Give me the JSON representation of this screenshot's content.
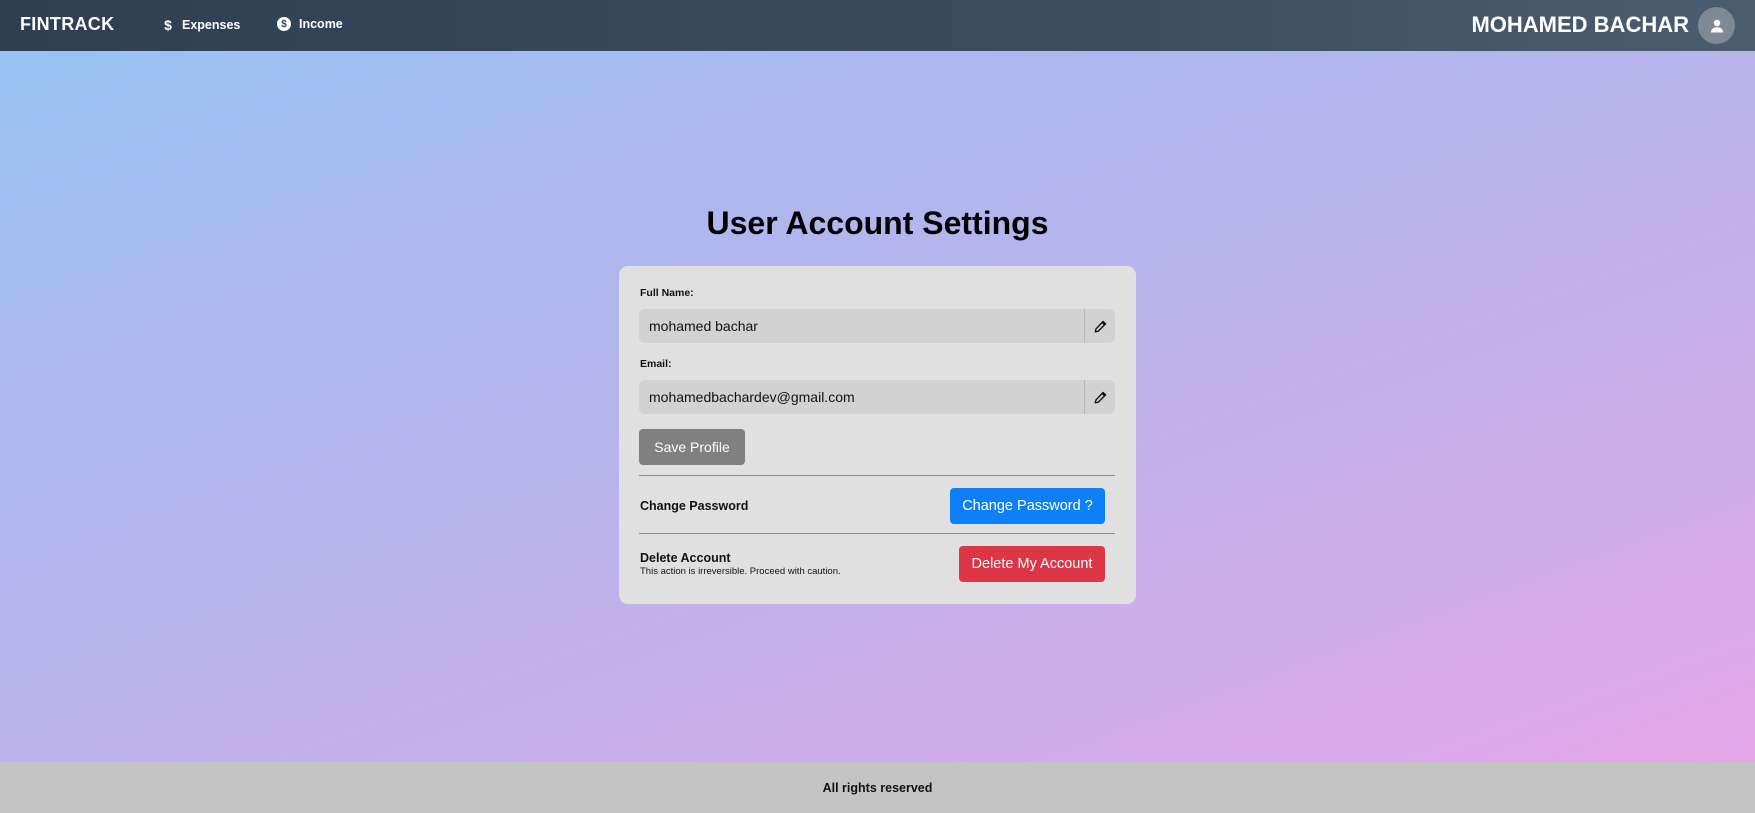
{
  "navbar": {
    "brand": "FINTRACK",
    "links": [
      {
        "label": "Expenses",
        "icon": "dollar-icon",
        "icon_glyph": "$"
      },
      {
        "label": "Income",
        "icon": "coin-icon",
        "icon_glyph": "$"
      }
    ],
    "user_name": "MOHAMED BACHAR",
    "avatar_icon": "user-icon"
  },
  "page": {
    "title": "User Account Settings"
  },
  "form": {
    "full_name_label": "Full Name:",
    "full_name_value": "mohamed bachar",
    "email_label": "Email:",
    "email_value": "mohamedbachardev@gmail.com",
    "edit_icon": "pencil-icon",
    "save_label": "Save Profile"
  },
  "password_section": {
    "title": "Change Password",
    "button_label": "Change Password ?"
  },
  "delete_section": {
    "title": "Delete Account",
    "subtitle": "This action is irreversible. Proceed with caution.",
    "button_label": "Delete My Account"
  },
  "footer": {
    "text": "All rights reserved"
  },
  "colors": {
    "navbar": "#34455a",
    "primary_button": "#0d7ff7",
    "danger_button": "#dc3546",
    "save_button": "#808080",
    "card": "#e0e0e0",
    "footer": "#c4c4c4"
  }
}
